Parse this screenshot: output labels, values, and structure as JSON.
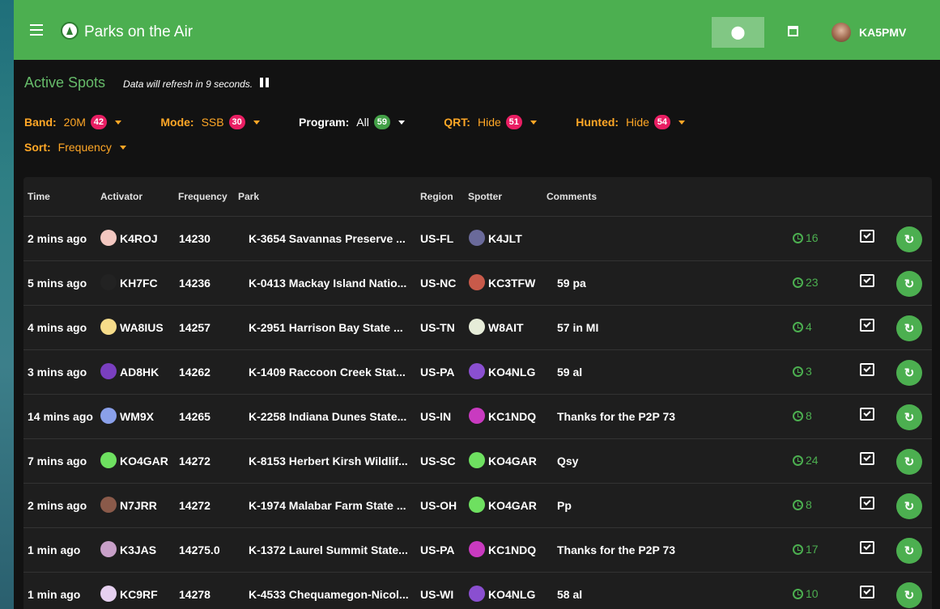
{
  "app": {
    "title": "Parks on the Air",
    "username": "KA5PMV"
  },
  "header": {
    "title": "Active Spots",
    "refresh_text": "Data will refresh in 9 seconds."
  },
  "filters": {
    "band": {
      "label": "Band:",
      "value": "20M",
      "count": "42"
    },
    "mode": {
      "label": "Mode:",
      "value": "SSB",
      "count": "30"
    },
    "program": {
      "label": "Program:",
      "value": "All",
      "count": "59"
    },
    "qrt": {
      "label": "QRT:",
      "value": "Hide",
      "count": "51"
    },
    "hunted": {
      "label": "Hunted:",
      "value": "Hide",
      "count": "54"
    },
    "sort": {
      "label": "Sort:",
      "value": "Frequency"
    }
  },
  "table": {
    "columns": [
      "Time",
      "Activator",
      "Frequency",
      "Park",
      "Region",
      "Spotter",
      "Comments"
    ],
    "rows": [
      {
        "time": "2 mins ago",
        "activator": "K4ROJ",
        "frequency": "14230",
        "park": "K-3654  Savannas Preserve ...",
        "region": "US-FL",
        "spotter": "K4JLT",
        "comments": "",
        "history": "16",
        "act_color": "#f3c7c0",
        "spot_color": "#6a6a9a"
      },
      {
        "time": "5 mins ago",
        "activator": "KH7FC",
        "frequency": "14236",
        "park": "K-0413  Mackay Island Natio...",
        "region": "US-NC",
        "spotter": "KC3TFW",
        "comments": "59 pa",
        "history": "23",
        "act_color": "#222222",
        "spot_color": "#c85a4a"
      },
      {
        "time": "4 mins ago",
        "activator": "WA8IUS",
        "frequency": "14257",
        "park": "K-2951  Harrison Bay State ...",
        "region": "US-TN",
        "spotter": "W8AIT",
        "comments": "57 in MI",
        "history": "4",
        "act_color": "#f6dc8a",
        "spot_color": "#e6ecd8"
      },
      {
        "time": "3 mins ago",
        "activator": "AD8HK",
        "frequency": "14262",
        "park": "K-1409  Raccoon Creek Stat...",
        "region": "US-PA",
        "spotter": "KO4NLG",
        "comments": "59 al",
        "history": "3",
        "act_color": "#7a3fc0",
        "spot_color": "#8a4fd0"
      },
      {
        "time": "14 mins ago",
        "activator": "WM9X",
        "frequency": "14265",
        "park": "K-2258  Indiana Dunes State...",
        "region": "US-IN",
        "spotter": "KC1NDQ",
        "comments": "Thanks for the P2P 73",
        "history": "8",
        "act_color": "#8aa0ea",
        "spot_color": "#c93ac0"
      },
      {
        "time": "7 mins ago",
        "activator": "KO4GAR",
        "frequency": "14272",
        "park": "K-8153  Herbert Kirsh Wildlif...",
        "region": "US-SC",
        "spotter": "KO4GAR",
        "comments": "Qsy",
        "history": "24",
        "act_color": "#6ee060",
        "spot_color": "#6ee060"
      },
      {
        "time": "2 mins ago",
        "activator": "N7JRR",
        "frequency": "14272",
        "park": "K-1974  Malabar Farm State ...",
        "region": "US-OH",
        "spotter": "KO4GAR",
        "comments": "Pp",
        "history": "8",
        "act_color": "#8a5a4a",
        "spot_color": "#6ee060"
      },
      {
        "time": "1 min ago",
        "activator": "K3JAS",
        "frequency": "14275.0",
        "park": "K-1372  Laurel Summit State...",
        "region": "US-PA",
        "spotter": "KC1NDQ",
        "comments": "Thanks for the P2P 73",
        "history": "17",
        "act_color": "#c8a0c8",
        "spot_color": "#c93ac0"
      },
      {
        "time": "1 min ago",
        "activator": "KC9RF",
        "frequency": "14278",
        "park": "K-4533  Chequamegon-Nicol...",
        "region": "US-WI",
        "spotter": "KO4NLG",
        "comments": "58 al",
        "history": "10",
        "act_color": "#e6d0f0",
        "spot_color": "#8a4fd0"
      }
    ]
  },
  "icons": {
    "menu": "hamburger-icon",
    "location": "map-marker-icon",
    "calendar": "calendar-icon",
    "history": "history-icon",
    "comment": "comment-check-icon",
    "respot": "refresh-icon"
  },
  "colors": {
    "accent": "#4caf50",
    "filter": "#ffa726",
    "badge": "#e91e63",
    "background": "#121212"
  }
}
